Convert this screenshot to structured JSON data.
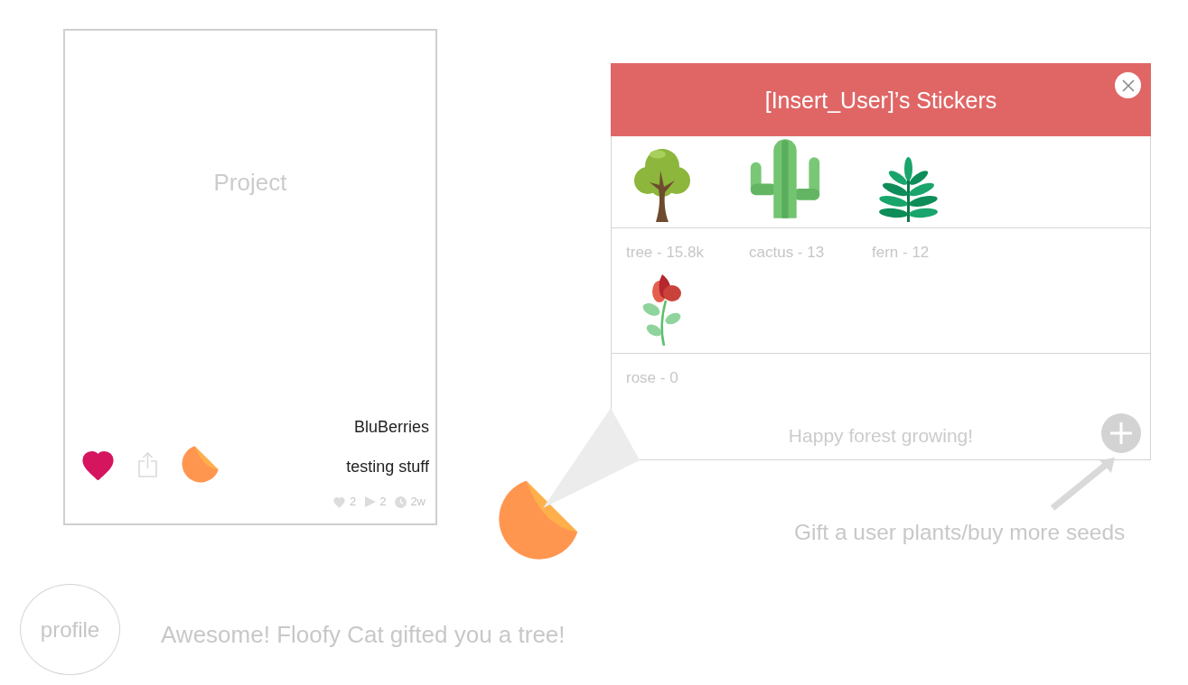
{
  "project_card": {
    "title": "Project",
    "liked": true,
    "author": "BluBerries",
    "caption": "testing stuff",
    "stats": [
      {
        "kind": "likes",
        "value": "2"
      },
      {
        "kind": "plays",
        "value": "2"
      },
      {
        "kind": "age",
        "value": "2w"
      }
    ]
  },
  "sticker_panel": {
    "title": "[Insert_User]’s Stickers",
    "stickers": [
      {
        "kind": "tree",
        "label": "tree - 15.8k"
      },
      {
        "kind": "cactus",
        "label": "cactus - 13"
      },
      {
        "kind": "fern",
        "label": "fern - 12"
      },
      {
        "kind": "rose",
        "label": "rose - 0"
      }
    ],
    "footer": "Happy forest growing!"
  },
  "gift_note": "Gift a user plants/buy more seeds",
  "profile": {
    "label": "profile"
  },
  "notification": "Awesome! Floofy Cat gifted you a tree!"
}
